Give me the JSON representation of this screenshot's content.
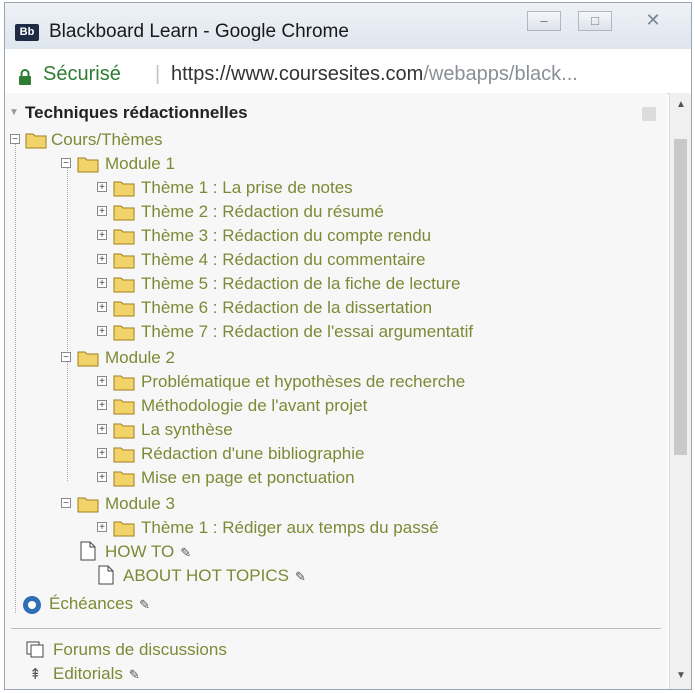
{
  "window": {
    "title": "Blackboard Learn - Google Chrome",
    "app_icon_text": "Bb",
    "buttons": {
      "minimize": "–",
      "maximize": "□",
      "close": "✕"
    }
  },
  "address_bar": {
    "secure_label": "Sécurisé",
    "separator": "|",
    "url_main": "https://www.coursesites.com",
    "url_rest": "/webapps/black..."
  },
  "panel": {
    "header": "Techniques rédactionnelles"
  },
  "tree": {
    "root": "Cours/Thèmes",
    "module1": {
      "label": "Module 1",
      "items": [
        "Thème 1 : La prise de notes",
        "Thème 2 : Rédaction du résumé",
        "Thème 3 : Rédaction du compte rendu",
        "Thème 4 : Rédaction du commentaire",
        "Thème 5 : Rédaction de la fiche de lecture",
        "Thème 6 : Rédaction de la dissertation",
        "Thème 7 : Rédaction de l'essai argumentatif"
      ]
    },
    "module2": {
      "label": "Module 2",
      "items": [
        "Problématique et hypothèses de recherche",
        "Méthodologie de l'avant projet",
        "La synthèse",
        "Rédaction d'une bibliographie",
        "Mise en page et ponctuation"
      ]
    },
    "module3": {
      "label": "Module 3",
      "items": [
        "Thème 1 : Rédiger aux temps du passé"
      ]
    },
    "how_to": "HOW TO",
    "about": "ABOUT HOT TOPICS",
    "echeances": "Échéances",
    "forums": "Forums de discussions",
    "editorials": "Editorials"
  },
  "colors": {
    "link_green": "#7c8a36",
    "folder_yellow": "#f1d36a",
    "secure_green": "#2e7d32"
  }
}
